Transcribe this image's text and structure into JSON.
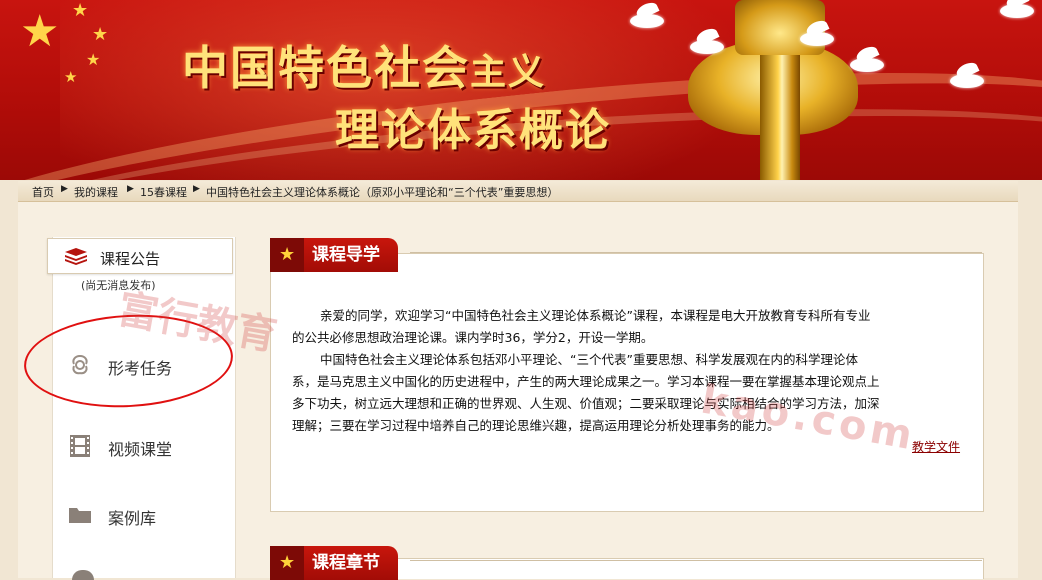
{
  "banner": {
    "title_line1_big": "中国特色社会",
    "title_line1_small": "主义",
    "title_line2_big": "理论体系概论"
  },
  "breadcrumb": [
    "首页",
    "我的课程",
    "15春课程",
    "中国特色社会主义理论体系概论（原邓小平理论和“三个代表”重要思想）"
  ],
  "sidebar": {
    "notice_label": "课程公告",
    "notice_sub": "(尚无消息发布)",
    "items": [
      {
        "label": "形考任务",
        "icon": "flower-icon"
      },
      {
        "label": "视频课堂",
        "icon": "film-icon"
      },
      {
        "label": "案例库",
        "icon": "folder-icon"
      }
    ]
  },
  "intro_panel": {
    "title": "课程导学",
    "para1_line1": "亲爱的同学，欢迎学习“中国特色社会主义理论体系概论”课程，本课程是电大开放教育专科所有专业",
    "para1_line2": "的公共必修思想政治理论课。课内学时36，学分2，开设一学期。",
    "para2_line1": "中国特色社会主义理论体系包括邓小平理论、“三个代表”重要思想、科学发展观在内的科学理论体",
    "para2_line2": "系，是马克思主义中国化的历史进程中，产生的两大理论成果之一。学习本课程一要在掌握基本理论观点上",
    "para2_line3": "多下功夫，树立远大理想和正确的世界观、人生观、价值观；二要采取理论与实际相结合的学习方法，加深",
    "para2_line4": "理解；三要在学习过程中培养自己的理论思维兴趣，提高运用理论分析处理事务的能力。",
    "doc_link": "教学文件"
  },
  "chapter_panel": {
    "title": "课程章节"
  },
  "watermark": {
    "text1": "富行教育",
    "text2": "kao.com"
  },
  "colors": {
    "banner_red": "#c8140f",
    "tab_red": "#b0100a",
    "gold": "#ffe27a",
    "circle": "#e01010"
  }
}
